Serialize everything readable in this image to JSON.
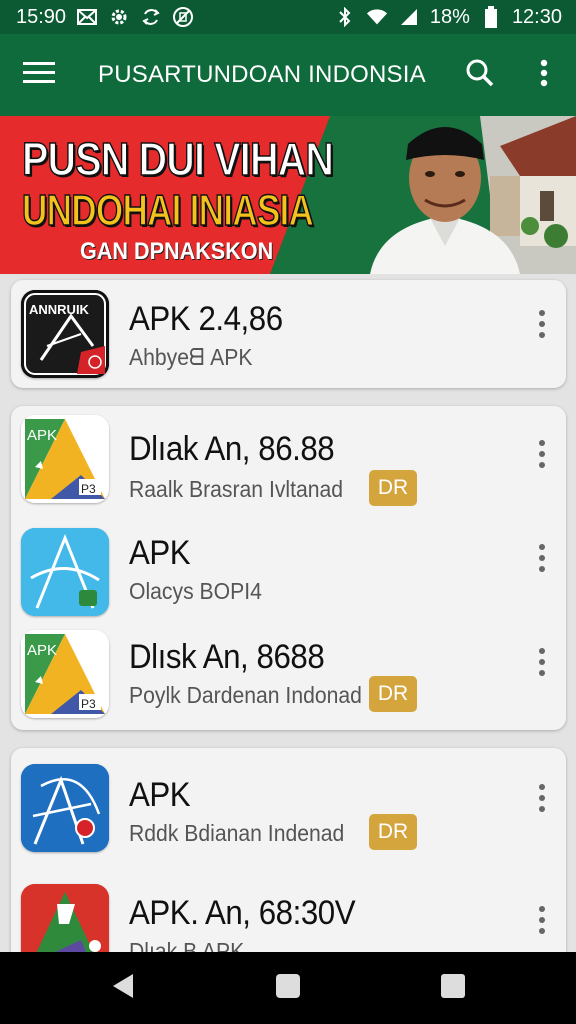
{
  "status_bar": {
    "time": "15:90",
    "battery": "18%",
    "clock": "12:30",
    "icons": [
      "mail-icon",
      "settings-icon",
      "sync-icon",
      "no-sim-icon",
      "bluetooth-icon",
      "wifi-icon",
      "signal-icon",
      "battery-icon"
    ]
  },
  "app_bar": {
    "title": "PUSARTUNDOAN INDONSIA",
    "icons": [
      "menu-icon",
      "search-icon",
      "more-vert-icon"
    ]
  },
  "banner": {
    "line1": "PUSN DUI VIHAN",
    "line2": "UNDOHAI INIASIA",
    "line3": "GAN DPNAKSKON"
  },
  "cards": [
    {
      "rows": [
        {
          "icon_label": "ANNRUIK",
          "title": "APK 2.4,86",
          "subtitle": "Ahbyeᗺ APK",
          "badge": ""
        }
      ]
    },
    {
      "rows": [
        {
          "icon_label": "APK",
          "title": "Dlıak An, 86.88",
          "subtitle": "Raalk Brasran Ivltanad",
          "badge": "DR"
        },
        {
          "icon_label": "",
          "title": "APK",
          "subtitle": "Olacys BOPI4",
          "badge": ""
        },
        {
          "icon_label": "APK",
          "title": "Dlısk An, 8688",
          "subtitle": "Poylk Dardenan Indonad",
          "badge": "DR"
        }
      ]
    },
    {
      "rows": [
        {
          "icon_label": "",
          "title": "APK",
          "subtitle": "Rddk Bdianan Indenad",
          "badge": "DR"
        },
        {
          "icon_label": "",
          "title": "APK. An, 68:30V",
          "subtitle": "Dlıak B APK",
          "badge": ""
        }
      ]
    }
  ],
  "colors": {
    "status_bar": "#0c5a33",
    "app_bar": "#0f6a3c",
    "badge": "#d4a53d",
    "banner_red": "#e52b2b",
    "banner_green": "#17723d"
  },
  "nav_bar": {
    "icons": [
      "back-icon",
      "home-icon",
      "recents-icon"
    ]
  }
}
